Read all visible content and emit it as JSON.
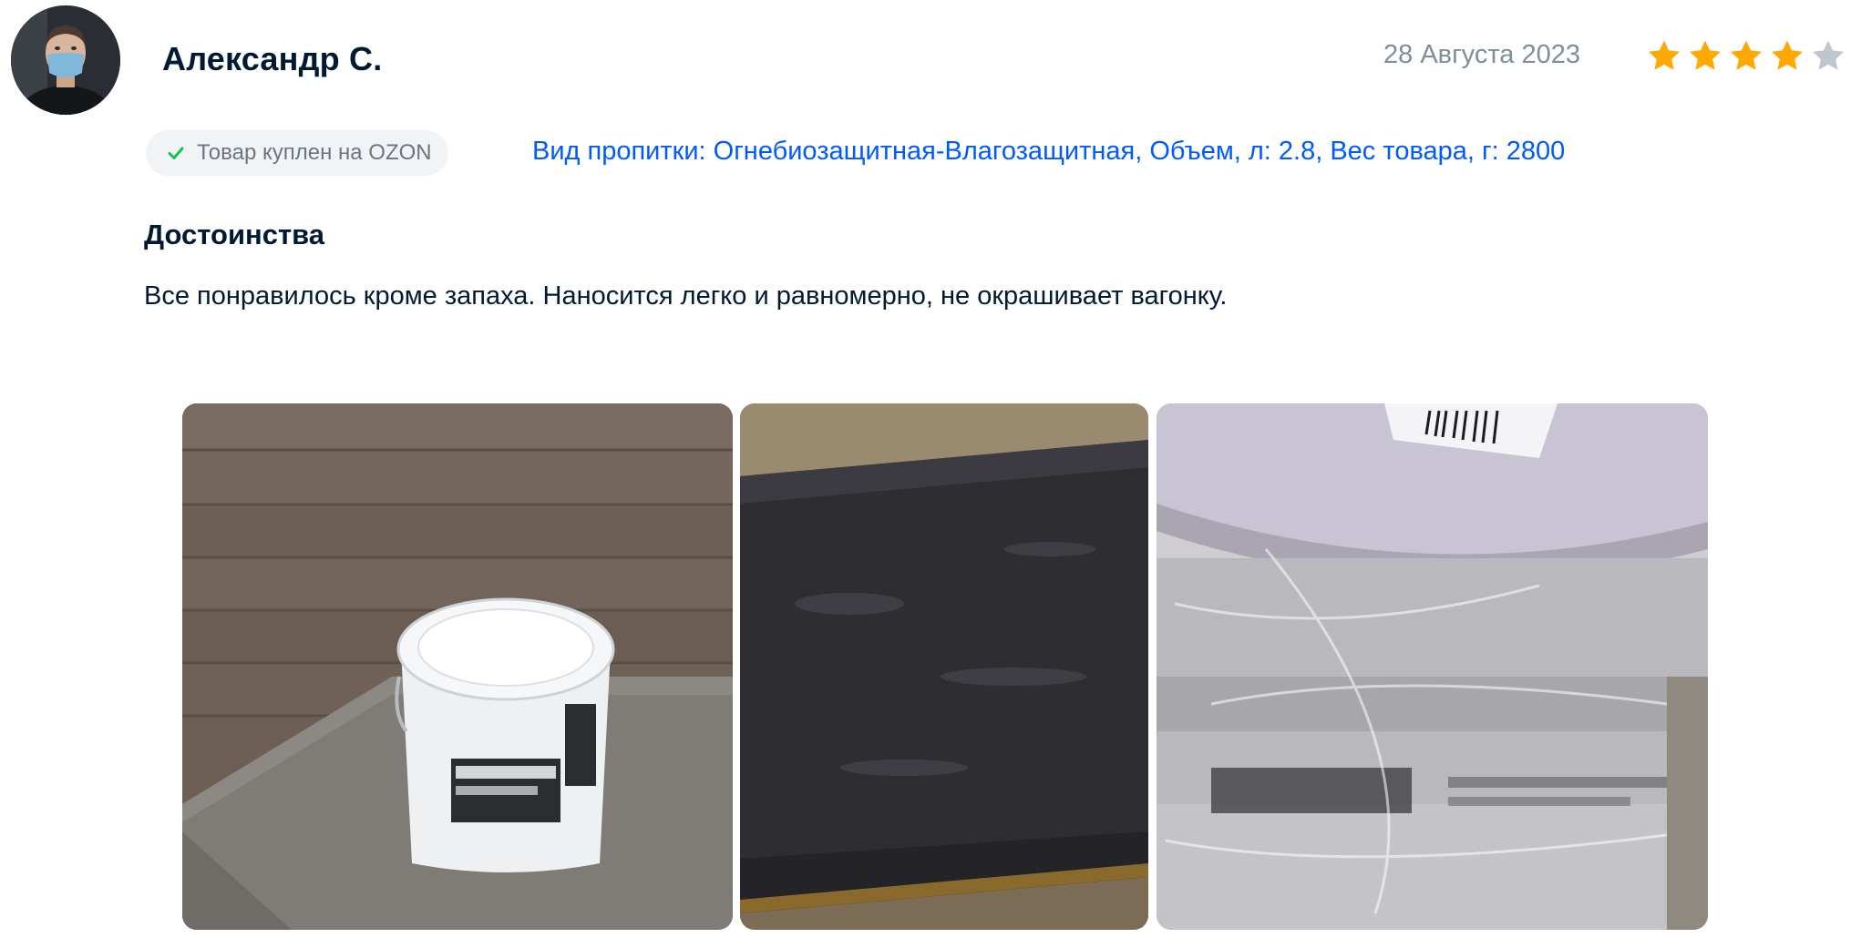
{
  "review": {
    "author": "Александр С.",
    "date": "28 Августа 2023",
    "rating": 4,
    "rating_max": 5,
    "verified_label": "Товар куплен на OZON",
    "variant": "Вид пропитки: Огнебиозащитная-Влагозащитная, Объем, л: 2.8, Вес товара, г: 2800",
    "pros_title": "Достоинства",
    "pros_text": "Все понравилось кроме запаха. Наносится легко и равномерно, не окрашивает вагонку.",
    "photos": [
      {
        "caption": "paint-can-on-bench-photo"
      },
      {
        "caption": "treated-board-photo"
      },
      {
        "caption": "wrapped-can-photo"
      }
    ]
  },
  "colors": {
    "star_filled": "#ffa800",
    "star_empty": "#c0c6cf",
    "link": "#005bff",
    "verified_check": "#10c44c",
    "muted_text": "#808d9a"
  }
}
